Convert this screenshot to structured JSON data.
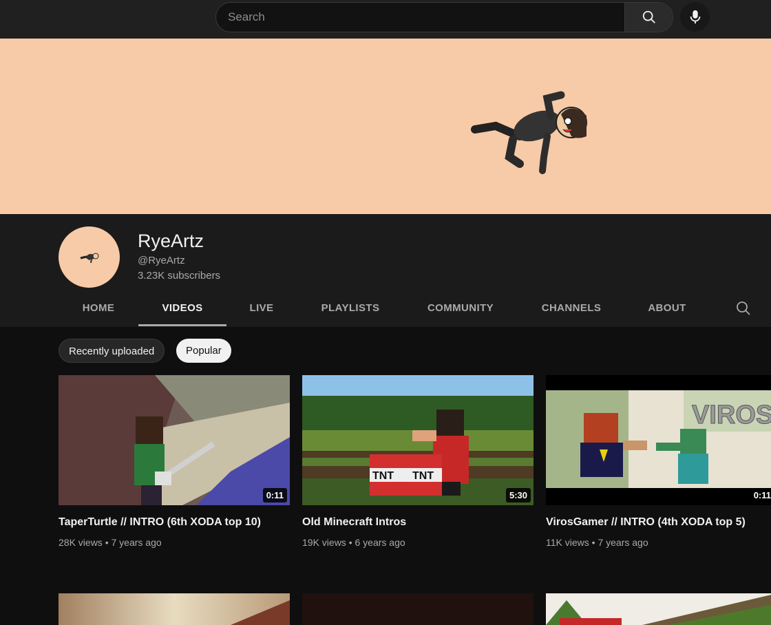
{
  "search": {
    "placeholder": "Search"
  },
  "icons": {
    "search": "search-icon",
    "mic": "mic-icon",
    "tab_search": "search-icon"
  },
  "colors": {
    "banner": "#f7caa8",
    "background": "#0f0f0f",
    "header": "#1b1b1b"
  },
  "channel": {
    "name": "RyeArtz",
    "handle": "@RyeArtz",
    "subscribers": "3.23K subscribers"
  },
  "tabs": [
    {
      "label": "HOME",
      "active": false
    },
    {
      "label": "VIDEOS",
      "active": true
    },
    {
      "label": "LIVE",
      "active": false
    },
    {
      "label": "PLAYLISTS",
      "active": false
    },
    {
      "label": "COMMUNITY",
      "active": false
    },
    {
      "label": "CHANNELS",
      "active": false
    },
    {
      "label": "ABOUT",
      "active": false
    }
  ],
  "chips": [
    {
      "label": "Recently uploaded",
      "active": false
    },
    {
      "label": "Popular",
      "active": true
    }
  ],
  "videos": [
    {
      "title": "TaperTurtle // INTRO (6th XODA top 10)",
      "views": "28K views",
      "age": "7 years ago",
      "duration": "0:11"
    },
    {
      "title": "Old Minecraft Intros",
      "views": "19K views",
      "age": "6 years ago",
      "duration": "5:30"
    },
    {
      "title": "VirosGamer // INTRO (4th XODA top 5)",
      "views": "11K views",
      "age": "7 years ago",
      "duration": "0:11"
    }
  ],
  "thumb_text": {
    "tnt_left": "TNT",
    "tnt_right": "TNT",
    "viros": "VIROS"
  }
}
